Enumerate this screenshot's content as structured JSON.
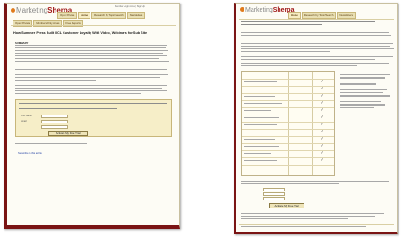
{
  "left": {
    "top_links": "Member Login Area | Sign Up",
    "logo_marketing": "Marketing",
    "logo_sherpa": "Sherpa",
    "nav": [
      "Open Private",
      "Home",
      "Research by Topic/Search",
      "Newsletters"
    ],
    "subnav": [
      "Open Private",
      "Members Only Areas",
      "Free Reports"
    ],
    "headline": "How Summer Press Built RCL Customer Loyalty With Video, Webinars for Sub Site",
    "summary_label": "SUMMARY",
    "form_label": "First Name",
    "form_label2": "Email",
    "submit": "Activate My Free Trial",
    "footer_link": "Subscribe to this article"
  },
  "right": {
    "logo_marketing": "Marketing",
    "logo_sherpa": "Sherpa",
    "nav": [
      "Home",
      "Research by Topic/Search",
      "Newsletters"
    ],
    "submit": "Activate My Free Trial"
  }
}
